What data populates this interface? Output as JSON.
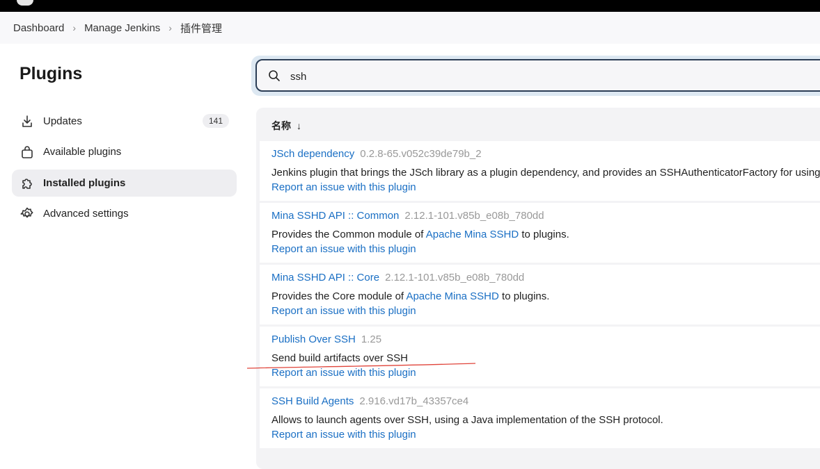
{
  "breadcrumb": {
    "items": [
      "Dashboard",
      "Manage Jenkins",
      "插件管理"
    ]
  },
  "sidebar": {
    "title": "Plugins",
    "items": [
      {
        "label": "Updates",
        "badge": "141",
        "icon": "download-icon"
      },
      {
        "label": "Available plugins",
        "icon": "shopping-bag-icon"
      },
      {
        "label": "Installed plugins",
        "icon": "puzzle-icon",
        "active": true
      },
      {
        "label": "Advanced settings",
        "icon": "gear-icon"
      }
    ]
  },
  "search": {
    "value": "ssh",
    "icon": "search-icon"
  },
  "table": {
    "column_header": "名称",
    "sort_indicator": "↓",
    "report_label": "Report an issue with this plugin",
    "plugins": [
      {
        "name": "JSch dependency",
        "version": "0.2.8-65.v052c39de79b_2",
        "desc_prefix": "Jenkins plugin that brings the JSch library as a plugin dependency, and provides an SSHAuthenticatorFactory for using",
        "desc_link": "",
        "desc_suffix": ""
      },
      {
        "name": "Mina SSHD API :: Common",
        "version": "2.12.1-101.v85b_e08b_780dd",
        "desc_prefix": "Provides the Common module of ",
        "desc_link": "Apache Mina SSHD",
        "desc_suffix": " to plugins."
      },
      {
        "name": "Mina SSHD API :: Core",
        "version": "2.12.1-101.v85b_e08b_780dd",
        "desc_prefix": "Provides the Core module of ",
        "desc_link": "Apache Mina SSHD",
        "desc_suffix": " to plugins."
      },
      {
        "name": "Publish Over SSH",
        "version": "1.25",
        "desc_prefix": "Send build artifacts over SSH",
        "desc_link": "",
        "desc_suffix": ""
      },
      {
        "name": "SSH Build Agents",
        "version": "2.916.vd17b_43357ce4",
        "desc_prefix": "Allows to launch agents over SSH, using a Java implementation of the SSH protocol.",
        "desc_link": "",
        "desc_suffix": ""
      }
    ]
  },
  "colors": {
    "link": "#1a6fc4",
    "annotation": "#e0443a"
  }
}
